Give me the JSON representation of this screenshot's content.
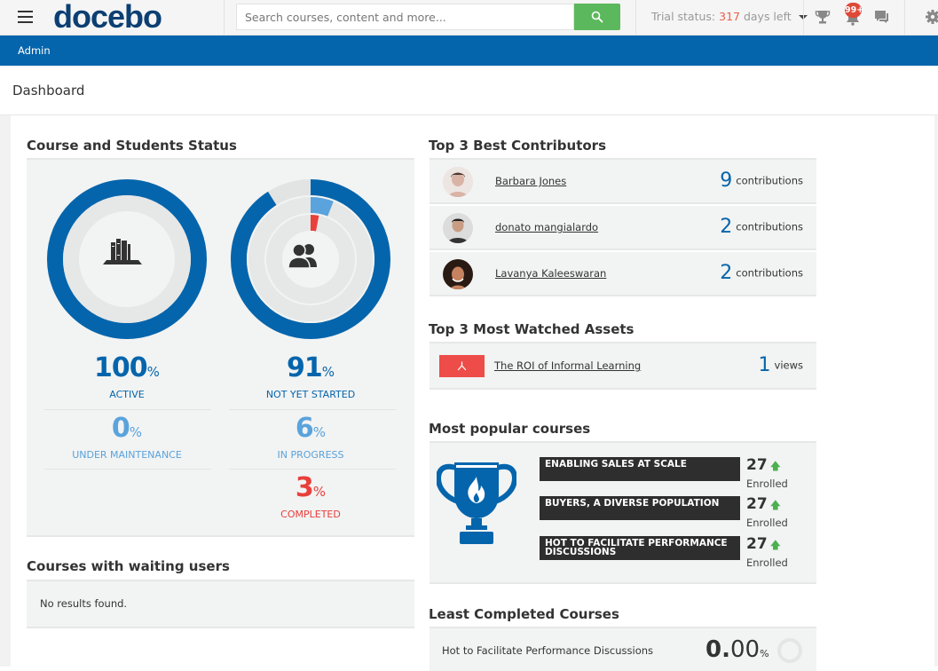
{
  "header": {
    "logo": "docebo",
    "logo_mark": "®",
    "search_placeholder": "Search courses, content and more...",
    "trial_prefix": "Trial status: ",
    "trial_days": "317",
    "trial_suffix": " days left",
    "notification_badge": "99+",
    "icons": [
      "menu-icon",
      "search-icon",
      "trophy-icon",
      "notification-bell-icon",
      "chat-icon",
      "gear-icon"
    ]
  },
  "admin_bar": {
    "label": "Admin"
  },
  "page": {
    "title": "Dashboard"
  },
  "course_status": {
    "title": "Course and Students Status",
    "courses_ring": {
      "active_pct": 100,
      "color": "#0465ac"
    },
    "students_ring": {
      "not_yet_started_pct": 91,
      "in_progress_pct": 6,
      "completed_pct": 3,
      "colors": {
        "not_yet_started": "#0465ac",
        "in_progress": "#5aa3dc",
        "completed": "#e8403b"
      }
    },
    "stats": {
      "active": {
        "value": "100",
        "unit": "%",
        "label": "ACTIVE"
      },
      "under_maintenance": {
        "value": "0",
        "unit": "%",
        "label": "UNDER MAINTENANCE"
      },
      "not_yet_started": {
        "value": "91",
        "unit": "%",
        "label": "NOT YET STARTED"
      },
      "in_progress": {
        "value": "6",
        "unit": "%",
        "label": "IN PROGRESS"
      },
      "completed": {
        "value": "3",
        "unit": "%",
        "label": "COMPLETED"
      }
    }
  },
  "waiting_users": {
    "title": "Courses with waiting users",
    "empty_text": "No results found."
  },
  "contributors": {
    "title": "Top 3 Best Contributors",
    "items": [
      {
        "name": "Barbara Jones",
        "count": "9",
        "unit": "contributions"
      },
      {
        "name": "donato mangialardo",
        "count": "2",
        "unit": "contributions"
      },
      {
        "name": "Lavanya Kaleeswaran",
        "count": "2",
        "unit": "contributions"
      }
    ]
  },
  "watched_assets": {
    "title": "Top 3 Most Watched Assets",
    "items": [
      {
        "name": "The ROI of Informal Learning",
        "count": "1",
        "unit": "views",
        "type": "pdf"
      }
    ]
  },
  "popular_courses": {
    "title": "Most popular courses",
    "items": [
      {
        "name": "ENABLING SALES AT SCALE",
        "count": "27",
        "label": "Enrolled",
        "trend": "up"
      },
      {
        "name": "BUYERS, A DIVERSE POPULATION",
        "count": "27",
        "label": "Enrolled",
        "trend": "up"
      },
      {
        "name": "HOT TO FACILITATE PERFORMANCE DISCUSSIONS",
        "count": "27",
        "label": "Enrolled",
        "trend": "up"
      }
    ]
  },
  "least_completed": {
    "title": "Least Completed Courses",
    "items": [
      {
        "name": "Hot to Facilitate Performance Discussions",
        "value_int": "0.",
        "value_dec": "00",
        "unit": "%",
        "completion_pct": 0
      }
    ]
  }
}
